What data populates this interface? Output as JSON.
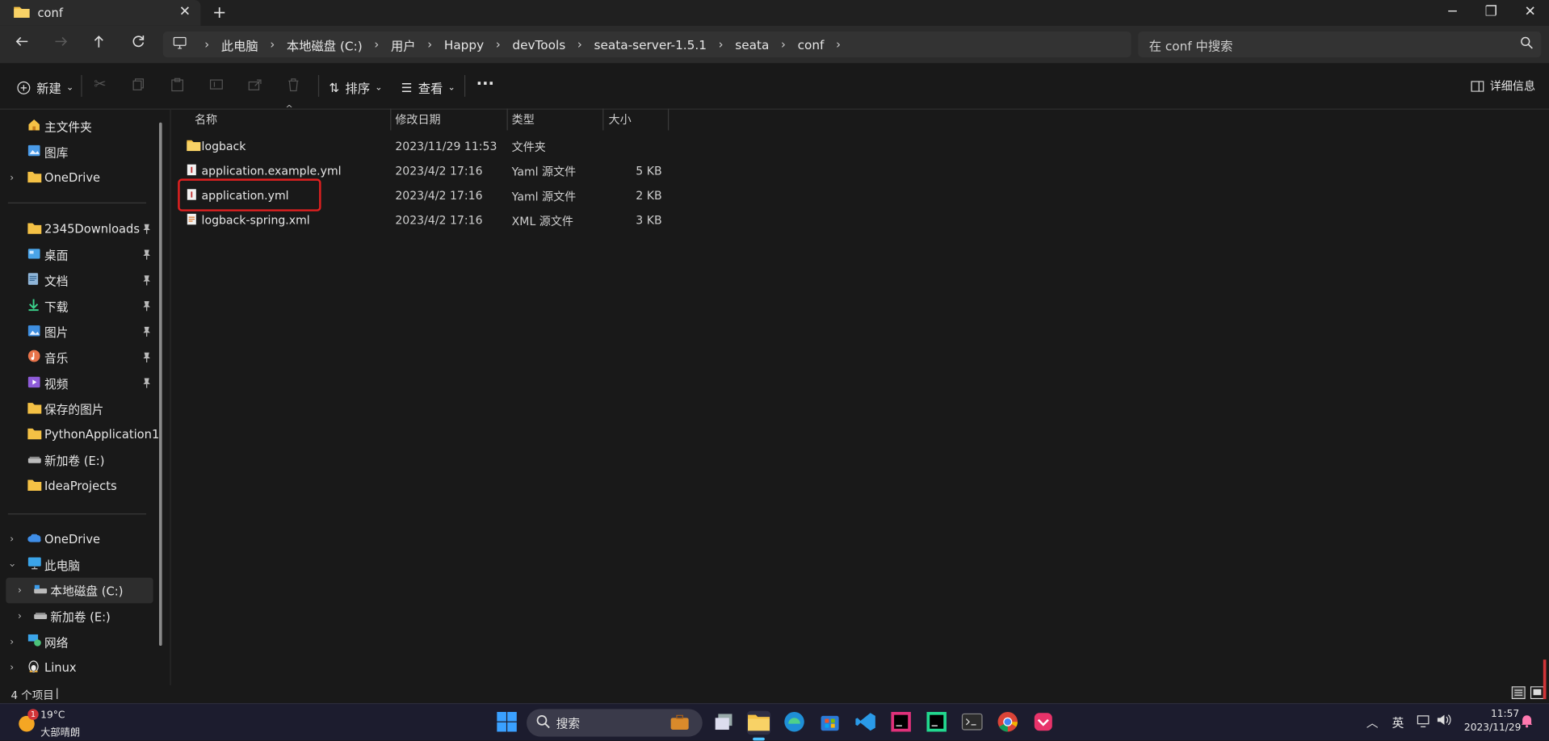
{
  "window": {
    "tab_title": "conf",
    "tab_close": "✕",
    "new_tab": "+",
    "minimize": "─",
    "maximize": "❐",
    "close": "✕"
  },
  "address": {
    "crumbs": [
      "此电脑",
      "本地磁盘 (C:)",
      "用户",
      "Happy",
      "devTools",
      "seata-server-1.5.1",
      "seata",
      "conf"
    ],
    "separator": "›",
    "search_placeholder": "在 conf 中搜索"
  },
  "toolbar": {
    "new_label": "新建",
    "sort_label": "排序",
    "view_label": "查看",
    "more_label": "···",
    "details_label": "详细信息"
  },
  "sidebar": {
    "top": [
      {
        "label": "主文件夹",
        "icon": "home-icon"
      },
      {
        "label": "图库",
        "icon": "gallery-icon"
      },
      {
        "label": "OneDrive",
        "icon": "folder-icon"
      }
    ],
    "quick": [
      {
        "label": "2345Downloads",
        "icon": "folder-icon",
        "pinned": true
      },
      {
        "label": "桌面",
        "icon": "desktop-icon",
        "pinned": true
      },
      {
        "label": "文档",
        "icon": "documents-icon",
        "pinned": true
      },
      {
        "label": "下载",
        "icon": "download-icon",
        "pinned": true
      },
      {
        "label": "图片",
        "icon": "pictures-icon",
        "pinned": true
      },
      {
        "label": "音乐",
        "icon": "music-icon",
        "pinned": true
      },
      {
        "label": "视频",
        "icon": "video-icon",
        "pinned": true
      },
      {
        "label": "保存的图片",
        "icon": "folder-icon",
        "pinned": false
      },
      {
        "label": "PythonApplication1",
        "icon": "folder-icon",
        "pinned": false
      },
      {
        "label": "新加卷 (E:)",
        "icon": "drive-icon",
        "pinned": false
      },
      {
        "label": "IdeaProjects",
        "icon": "folder-icon",
        "pinned": false
      }
    ],
    "tree": [
      {
        "label": "OneDrive",
        "icon": "cloud-icon"
      },
      {
        "label": "此电脑",
        "icon": "pc-icon"
      },
      {
        "label": "本地磁盘 (C:)",
        "icon": "drive-icon"
      },
      {
        "label": "新加卷 (E:)",
        "icon": "drive-icon"
      },
      {
        "label": "网络",
        "icon": "network-icon"
      },
      {
        "label": "Linux",
        "icon": "linux-icon"
      }
    ]
  },
  "files": {
    "columns": {
      "name": "名称",
      "date": "修改日期",
      "type": "类型",
      "size": "大小"
    },
    "rows": [
      {
        "name": "logback",
        "date": "2023/11/29 11:53",
        "type": "文件夹",
        "size": "",
        "icon": "folder-icon"
      },
      {
        "name": "application.example.yml",
        "date": "2023/4/2 17:16",
        "type": "Yaml 源文件",
        "size": "5 KB",
        "icon": "yaml-file-icon"
      },
      {
        "name": "application.yml",
        "date": "2023/4/2 17:16",
        "type": "Yaml 源文件",
        "size": "2 KB",
        "icon": "yaml-file-icon"
      },
      {
        "name": "logback-spring.xml",
        "date": "2023/4/2 17:16",
        "type": "XML 源文件",
        "size": "3 KB",
        "icon": "xml-file-icon"
      }
    ]
  },
  "status": {
    "count": "4 个项目",
    "cursor": "|"
  },
  "taskbar": {
    "weather_temp": "19°C",
    "weather_desc": "大部晴朗",
    "weather_badge": "1",
    "search_label": "搜索",
    "ime": "英",
    "time": "11:57",
    "date": "2023/11/29"
  },
  "colors": {
    "accent": "#4cc2ff",
    "highlight_box": "#e02020",
    "folder": "#f4c145"
  }
}
